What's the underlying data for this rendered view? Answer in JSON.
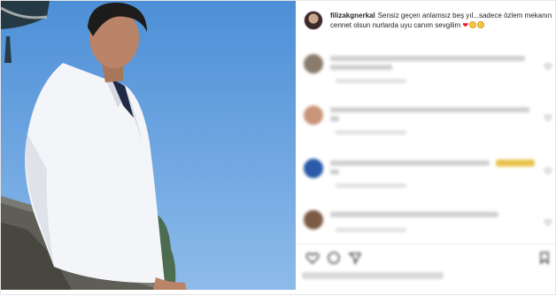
{
  "post": {
    "username": "filizakgnerkal",
    "caption": "Sensiz geçen anlamsız beş yıl...sadece özlem mekanın cennet olsun nurlarda uyu canım sevgilim"
  },
  "comments": [
    {
      "text": "",
      "meta": ""
    },
    {
      "text": "",
      "meta": ""
    },
    {
      "text": "",
      "meta": ""
    },
    {
      "text": "",
      "meta": ""
    }
  ],
  "colors": {
    "heart": "#ed1c24",
    "sky": "#6aa3e0",
    "suit": "#f4f5f8"
  },
  "icons": [
    "heart-icon",
    "comment-icon",
    "share-icon",
    "bookmark-icon"
  ]
}
